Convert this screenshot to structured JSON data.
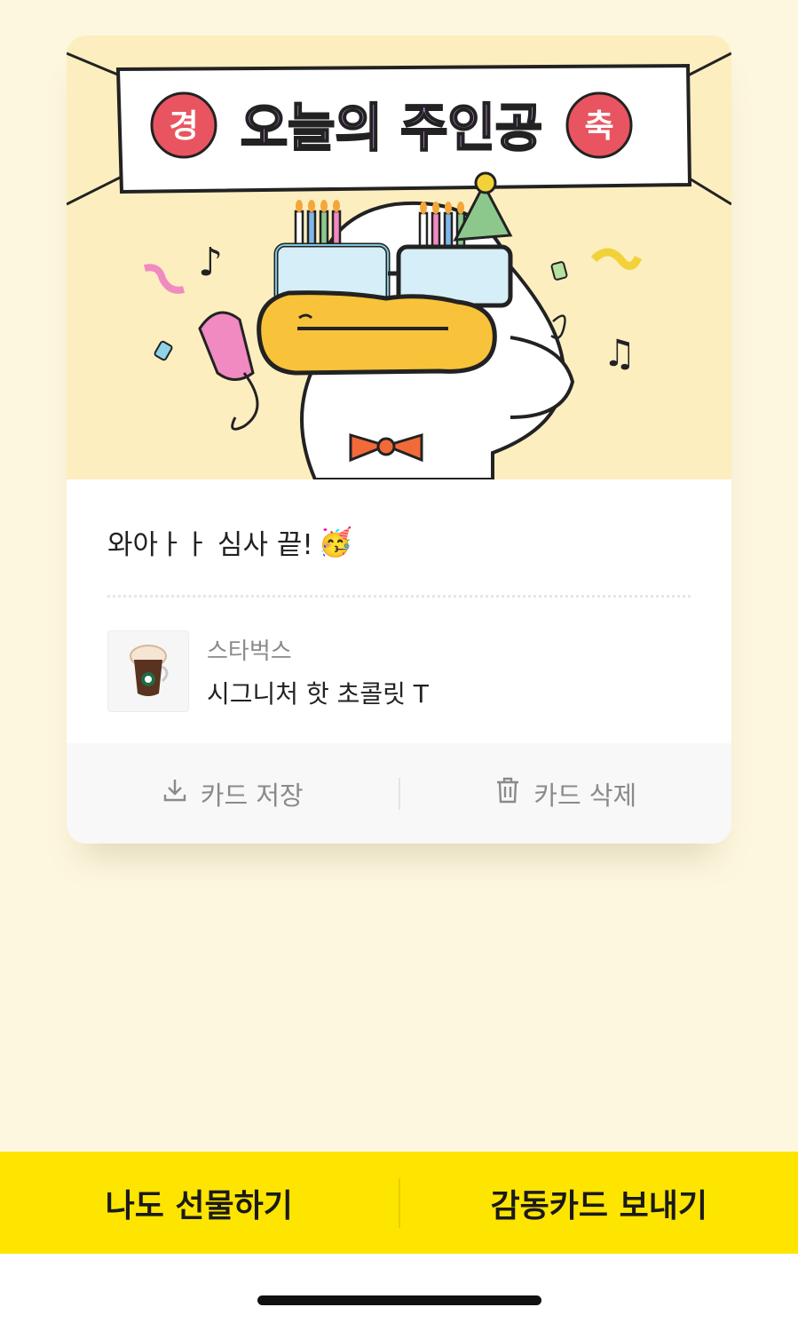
{
  "banner": {
    "title": "오늘의 주인공",
    "left_badge": "경",
    "right_badge": "축"
  },
  "card": {
    "message": "와아ㅏㅏ 심사 끝!",
    "emoji": "🥳",
    "product": {
      "brand": "스타벅스",
      "name": "시그니처 핫 초콜릿 T"
    },
    "actions": {
      "save_label": "카드 저장",
      "delete_label": "카드 삭제"
    }
  },
  "bottom": {
    "gift_label": "나도 선물하기",
    "send_label": "감동카드 보내기"
  },
  "colors": {
    "background": "#fdf7df",
    "banner_bg": "#fdeec0",
    "accent_yellow": "#fee500",
    "badge_red": "#e85560",
    "title_purple": "#b89ae6",
    "title_pink": "#f08ac0"
  }
}
